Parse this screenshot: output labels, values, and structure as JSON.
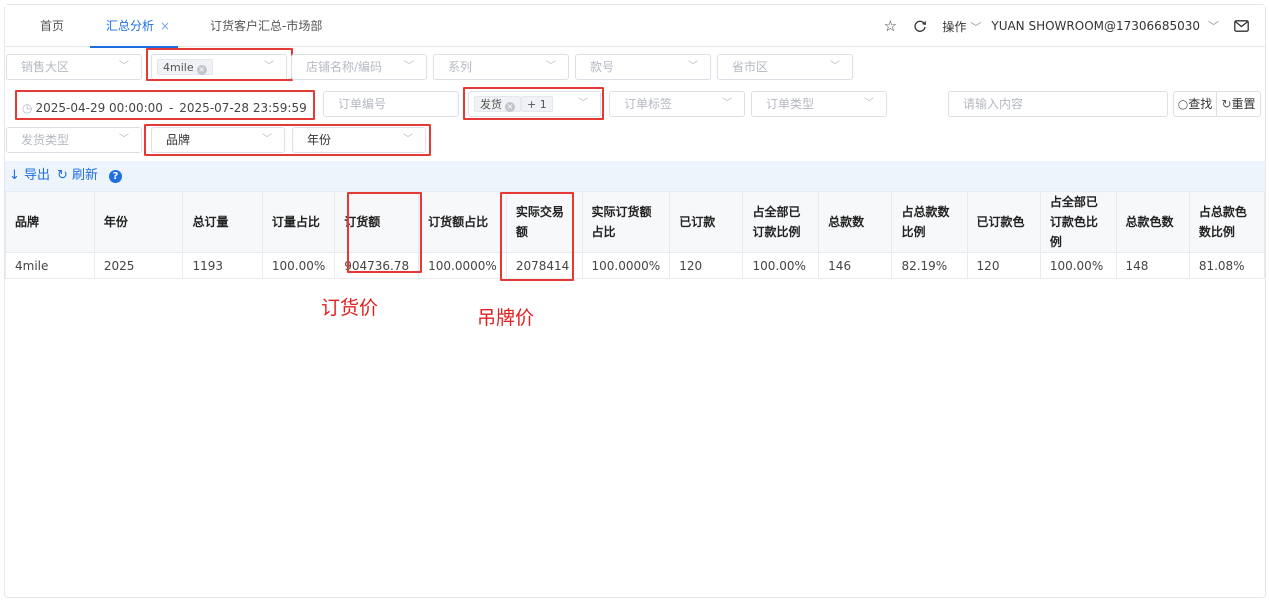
{
  "tabs": [
    {
      "label": "首页",
      "active": false
    },
    {
      "label": "汇总分析",
      "active": true,
      "closable": true,
      "close_label": "×"
    },
    {
      "label": "订货客户汇总-市场部",
      "active": false
    }
  ],
  "header": {
    "actions_label": "操作",
    "user_label": "YUAN SHOWROOM@17306685030"
  },
  "filters": {
    "sales_region": {
      "placeholder": "销售大区"
    },
    "brand_select": {
      "tag": "4mile"
    },
    "store": {
      "placeholder": "店铺名称/编码"
    },
    "series": {
      "placeholder": "系列"
    },
    "style_no": {
      "placeholder": "款号"
    },
    "province": {
      "placeholder": "省市区"
    },
    "date_start": "2025-04-29 00:00:00",
    "date_end": "2025-07-28 23:59:59",
    "date_sep": "-",
    "order_no": {
      "placeholder": "订单编号"
    },
    "status": {
      "tag": "发货",
      "extra": "+ 1"
    },
    "order_tag": {
      "placeholder": "订单标签"
    },
    "order_type": {
      "placeholder": "订单类型"
    },
    "keyword": {
      "placeholder": "请输入内容"
    },
    "ship_type": {
      "placeholder": "发货类型"
    },
    "group_brand": {
      "value": "品牌"
    },
    "group_year": {
      "value": "年份"
    }
  },
  "buttons": {
    "search": "查找",
    "reset": "重置"
  },
  "toolbar": {
    "export": "导出",
    "refresh": "刷新",
    "help": "?"
  },
  "table": {
    "columns": [
      "品牌",
      "年份",
      "总订量",
      "订量占比",
      "订货额",
      "订货额占比",
      "实际交易额",
      "实际订货额占比",
      "已订款",
      "占全部已订款比例",
      "总款数",
      "占总款数比例",
      "已订款色",
      "占全部已订款色比例",
      "总款色数",
      "占总款色数比例"
    ],
    "rows": [
      [
        "4mile",
        "2025",
        "1193",
        "100.00%",
        "904736.78",
        "100.0000%",
        "2078414",
        "100.0000%",
        "120",
        "100.00%",
        "146",
        "82.19%",
        "120",
        "100.00%",
        "148",
        "81.08%"
      ]
    ]
  },
  "annotations": {
    "order_price": "订货价",
    "tag_price": "吊牌价"
  },
  "colors": {
    "accent": "#1f6fe0",
    "highlight_box": "#e53935",
    "annotation_text": "#e02020"
  }
}
